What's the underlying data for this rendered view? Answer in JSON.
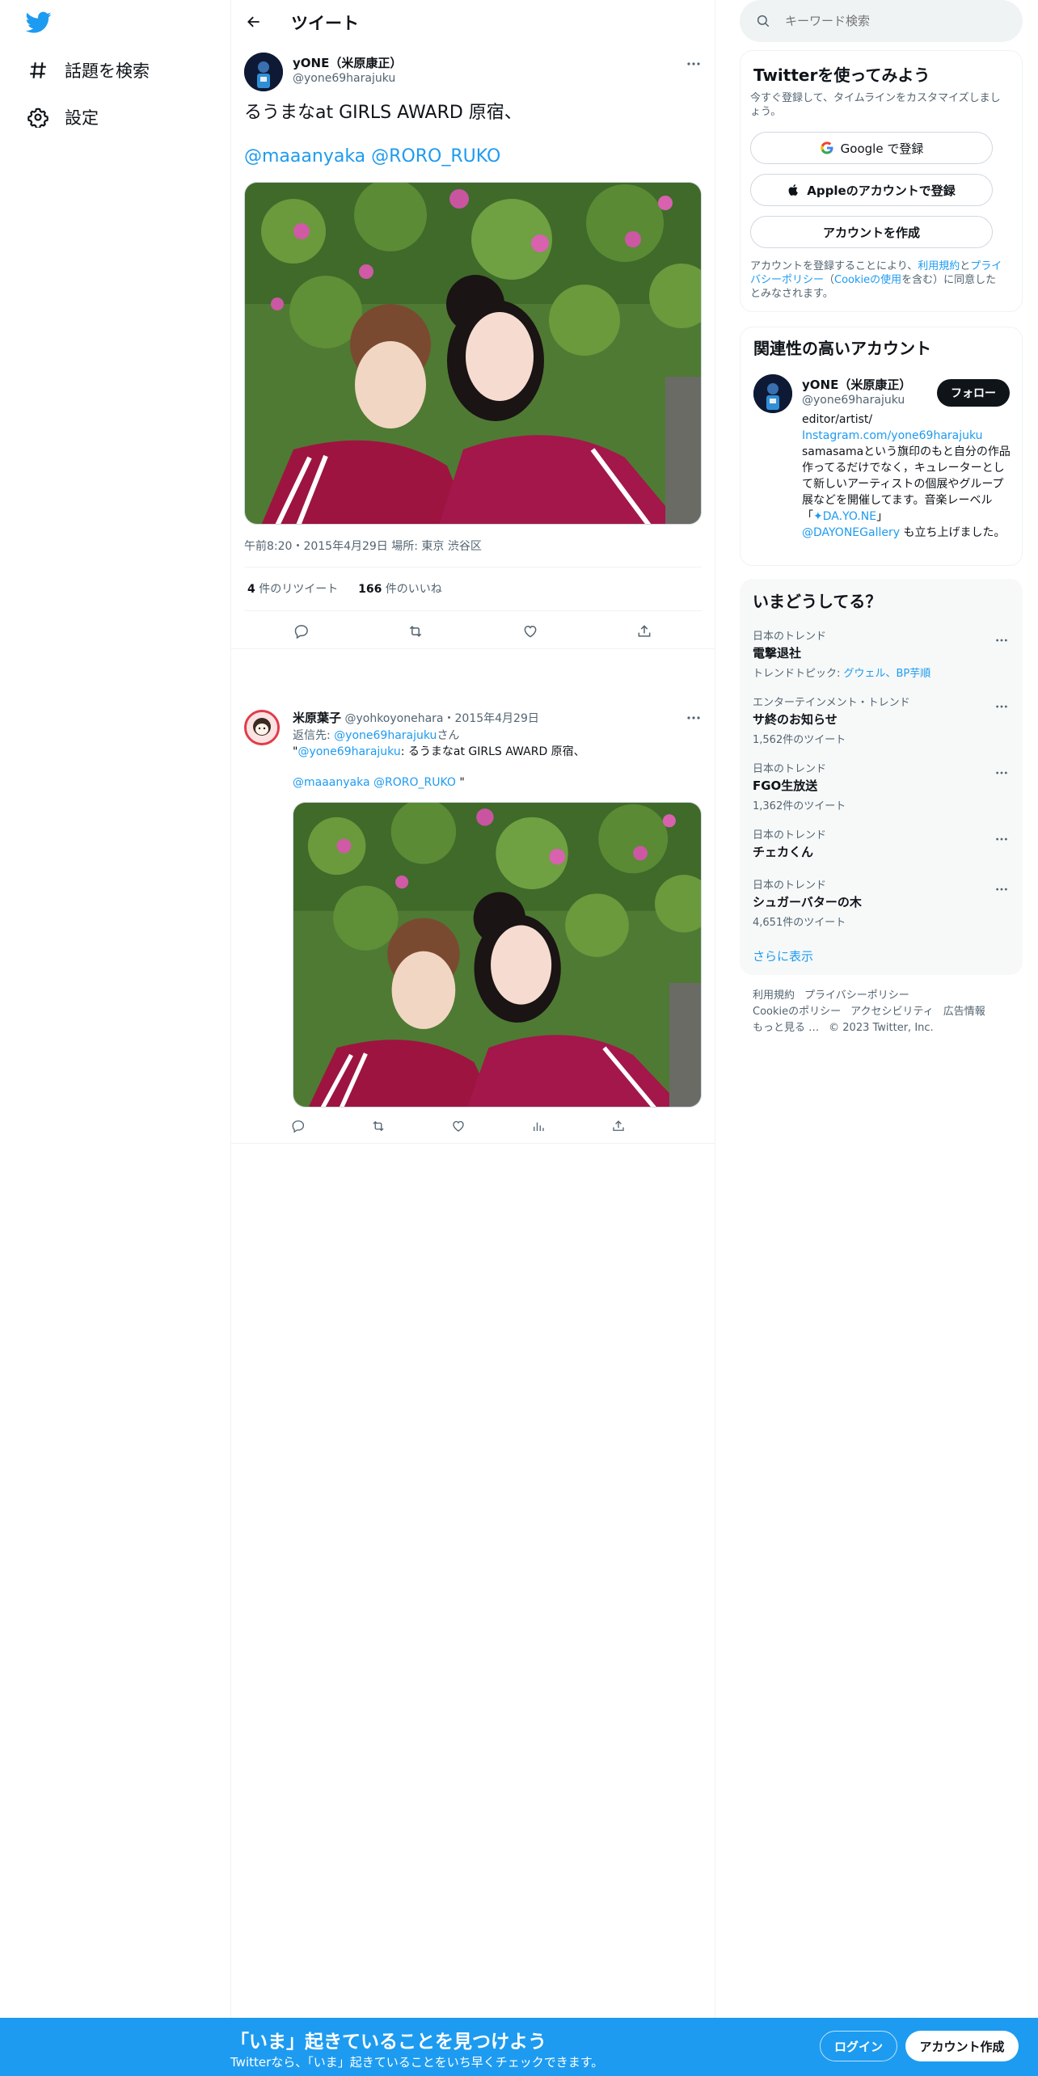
{
  "colors": {
    "brand": "#1d9bf0",
    "text": "#0f1419",
    "muted": "#536471"
  },
  "nav": {
    "items": [
      {
        "label": "話題を検索",
        "icon": "hashtag-icon"
      },
      {
        "label": "設定",
        "icon": "gear-icon"
      }
    ]
  },
  "header": {
    "title": "ツイート"
  },
  "main_tweet": {
    "name": "yONE（米原康正）",
    "handle": "@yone69harajuku",
    "text": "るうまなat GIRLS AWARD 原宿、",
    "mention1": "@maaanyaka",
    "mention2": "@RORO_RUKO",
    "meta": "午前8:20・2015年4月29日 場所: 東京 渋谷区",
    "retweet_count": "4",
    "retweet_label": "件のリツイート",
    "like_count": "166",
    "like_label": "件のいいね"
  },
  "reply": {
    "name": "米原葉子",
    "handle": "@yohkoyonehara",
    "date": "・2015年4月29日",
    "reply_prefix": "返信先: ",
    "reply_to": "@yone69harajuku",
    "reply_suffix": "さん",
    "quote_open": "\"",
    "quote_handle": "@yone69harajuku",
    "quote_text": ": るうまなat GIRLS AWARD 原宿、",
    "mention1": "@maaanyaka",
    "mention2": "@RORO_RUKO",
    "quote_close": " \""
  },
  "search": {
    "placeholder": "キーワード検索"
  },
  "signup_card": {
    "title": "Twitterを使ってみよう",
    "subtitle": "今すぐ登録して、タイムラインをカスタマイズしましょう。",
    "google_label": "Google で登録",
    "apple_label": "Appleのアカウントで登録",
    "create_label": "アカウントを作成",
    "legal_1": "アカウントを登録することにより、",
    "legal_terms": "利用規約",
    "legal_2": "と",
    "legal_privacy": "プライバシーポリシー",
    "legal_3": "（",
    "legal_cookie": "Cookieの使用",
    "legal_4": "を含む）に同意したとみなされます。"
  },
  "related_card": {
    "title": "関連性の高いアカウント",
    "name": "yONE（米原康正）",
    "handle": "@yone69harajuku",
    "follow_label": "フォロー",
    "bio_1": "editor/artist/",
    "bio_link1": "Instagram.com/yone69harajuku",
    "bio_2": "samasamaという旗印のもと自分の作品作ってるだけでなく，キュレーターとして新しいアーティストの個展やグループ展などを開催してます。音楽レーベル「",
    "bio_link2": "✦DA.YO.NE",
    "bio_3": "」",
    "bio_link3": "@DAYONEGallery",
    "bio_4": " も立ち上げました。"
  },
  "trends": {
    "title": "いまどうしてる？",
    "items": [
      {
        "category": "日本のトレンド",
        "name": "電撃退社",
        "sub_prefix": "トレンドトピック: ",
        "sub_links": "グウェル、BP芋順"
      },
      {
        "category": "エンターテインメント・トレンド",
        "name": "サ終のお知らせ",
        "sub": "1,562件のツイート"
      },
      {
        "category": "日本のトレンド",
        "name": "FGO生放送",
        "sub": "1,362件のツイート"
      },
      {
        "category": "日本のトレンド",
        "name": "チェカくん"
      },
      {
        "category": "日本のトレンド",
        "name": "シュガーバターの木",
        "sub": "4,651件のツイート"
      }
    ],
    "show_more": "さらに表示"
  },
  "footer": {
    "terms": "利用規約",
    "privacy": "プライバシーポリシー",
    "cookie": "Cookieのポリシー",
    "accessibility": "アクセシビリティ",
    "ads": "広告情報",
    "more": "もっと見る …",
    "copyright": "© 2023 Twitter, Inc."
  },
  "bottom_bar": {
    "title": "「いま」起きていることを見つけよう",
    "subtitle": "Twitterなら、「いま」起きていることをいち早くチェックできます。",
    "login_label": "ログイン",
    "signup_label": "アカウント作成"
  }
}
